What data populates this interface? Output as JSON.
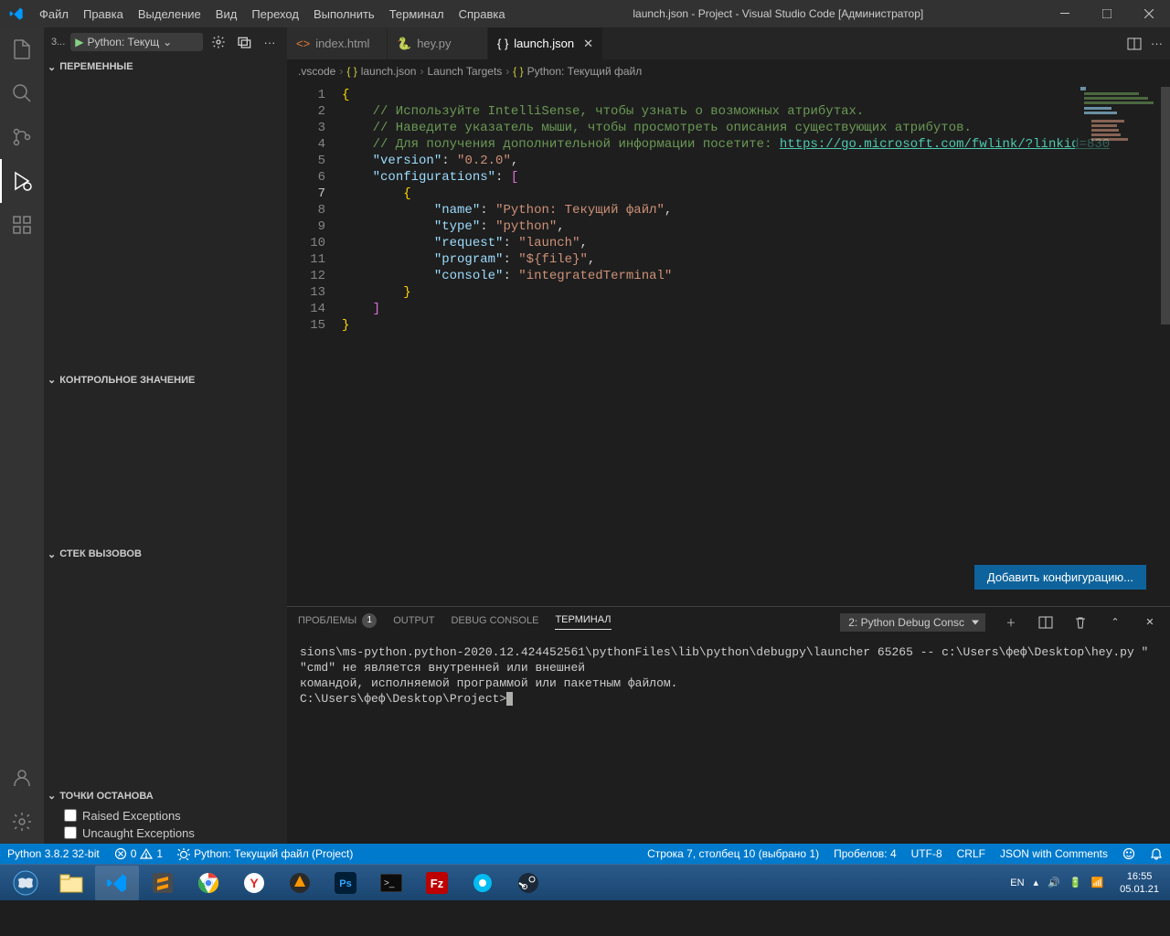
{
  "title": "launch.json - Project - Visual Studio Code [Администратор]",
  "menu": [
    "Файл",
    "Правка",
    "Выделение",
    "Вид",
    "Переход",
    "Выполнить",
    "Терминал",
    "Справка"
  ],
  "sidebar": {
    "three": "3...",
    "config_label": "Python: Текущ",
    "sections": {
      "vars": "Переменные",
      "watch": "Контрольное значение",
      "stack": "Стек вызовов",
      "breakpoints": "Точки останова"
    },
    "bp1": "Raised Exceptions",
    "bp2": "Uncaught Exceptions"
  },
  "tabs": [
    {
      "label": "index.html",
      "kind": "html"
    },
    {
      "label": "hey.py",
      "kind": "py"
    },
    {
      "label": "launch.json",
      "kind": "json",
      "active": true,
      "close": true
    }
  ],
  "breadcrumb": [
    ".vscode",
    "launch.json",
    "Launch Targets",
    "Python: Текущий файл"
  ],
  "editor": {
    "add_cfg": "Добавить конфигурацию...",
    "lines": [
      "{",
      "    // Используйте IntelliSense, чтобы узнать о возможных атрибутах.",
      "    // Наведите указатель мыши, чтобы просмотреть описания существующих атрибутов.",
      {
        "pre": "    // Для получения дополнительной информации посетите: ",
        "link": "https://go.microsoft.com/fwlink/?linkid=830"
      },
      {
        "k": "version",
        "v": "0.2.0",
        "comma": true,
        "indent": 1
      },
      {
        "k": "configurations",
        "arr": true,
        "indent": 1
      },
      "        {",
      {
        "k": "name",
        "v": "Python: Текущий файл",
        "comma": true,
        "indent": 3
      },
      {
        "k": "type",
        "v": "python",
        "comma": true,
        "indent": 3
      },
      {
        "k": "request",
        "v": "launch",
        "comma": true,
        "indent": 3
      },
      {
        "k": "program",
        "v": "${file}",
        "comma": true,
        "indent": 3
      },
      {
        "k": "console",
        "v": "integratedTerminal",
        "indent": 3
      },
      "        }",
      "    ]",
      "}"
    ]
  },
  "panel": {
    "tabs": {
      "problems": "Проблемы",
      "problems_count": "1",
      "output": "Output",
      "debug": "Debug Console",
      "terminal": "Терминал"
    },
    "term_select": "2: Python Debug Consc",
    "terminal_lines": [
      "sions\\ms-python.python-2020.12.424452561\\pythonFiles\\lib\\python\\debugpy\\launcher 65265 -- c:\\Users\\фeф\\Desktop\\hey.py \"",
      "\"cmd\" не является внутренней или внешней",
      "командой, исполняемой программой или пакетным файлом.",
      "",
      "C:\\Users\\фeф\\Desktop\\Project>"
    ]
  },
  "status": {
    "python": "Python 3.8.2 32-bit",
    "errors": "0",
    "warnings": "1",
    "debug": "Python: Текущий файл (Project)",
    "pos": "Строка 7, столбец 10 (выбрано 1)",
    "spaces": "Пробелов: 4",
    "enc": "UTF-8",
    "eol": "CRLF",
    "lang": "JSON with Comments"
  },
  "taskbar": {
    "lang": "EN",
    "time": "16:55",
    "date": "05.01.21"
  }
}
